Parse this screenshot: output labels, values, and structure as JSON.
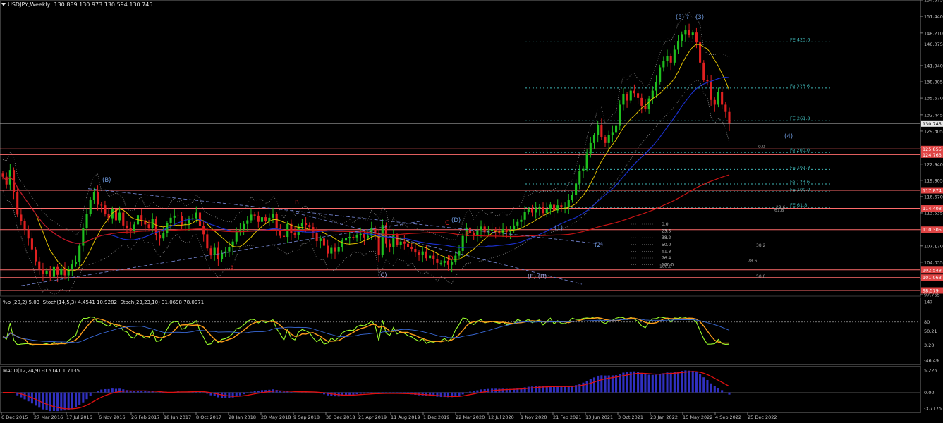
{
  "header": {
    "symbol_tf": "USDJPY,Weekly",
    "ohlc": "130.889 130.973 130.594 130.745"
  },
  "stoch_title": "%b (20,2) 5.03  Stoch(14,5,3) 4.4541 10.9282  Stoch(23,23,10) 31.0698 78.0971",
  "macd_title": "MACD(12,24,9) -0.5141 1.7135",
  "colors": {
    "bull": "#1fbf1f",
    "bear": "#e02020",
    "support": "#ff6b6b",
    "fib": "#3fb6b6",
    "ma_yellow": "#e0c000",
    "ma_blue": "#1a2fcc",
    "ma_red": "#c81414",
    "stoch_green": "#9aff2b",
    "stoch_orange": "#ff9e1a",
    "macd_hist": "#3030c0",
    "macd_signal": "#e01010",
    "current_price_box": "#e8e8e8"
  },
  "chart_data": {
    "type": "candlestick",
    "instrument": "USDJPY",
    "timeframe": "Weekly",
    "x_tick_labels": [
      "6 Dec 2015",
      "27 Mar 2016",
      "17 Jul 2016",
      "6 Nov 2016",
      "26 Feb 2017",
      "18 Jun 2017",
      "8 Oct 2017",
      "28 Jan 2018",
      "20 May 2018",
      "9 Sep 2018",
      "30 Dec 2018",
      "21 Apr 2019",
      "11 Aug 2019",
      "1 Dec 2019",
      "22 Mar 2020",
      "12 Jul 2020",
      "1 Nov 2020",
      "21 Feb 2021",
      "13 Jun 2021",
      "3 Oct 2021",
      "23 Jan 2022",
      "15 May 2022",
      "4 Sep 2022",
      "25 Dec 2022"
    ],
    "price_axis": {
      "ylim": [
        97.49,
        154.575
      ],
      "tick_labels": [
        "154.575",
        "151.440",
        "148.210",
        "146.075",
        "141.940",
        "138.805",
        "135.670",
        "132.445",
        "129.305",
        "126.170",
        "122.940",
        "119.805",
        "116.670",
        "113.535",
        "110.305",
        "107.170",
        "104.035",
        "100.900",
        "97.765"
      ]
    },
    "price_labels": [
      {
        "text": "130.745",
        "value": 130.745,
        "kind": "current"
      },
      {
        "text": "125.855",
        "value": 125.855,
        "kind": "level"
      },
      {
        "text": "124.763",
        "value": 124.763,
        "kind": "level"
      },
      {
        "text": "117.874",
        "value": 117.874,
        "kind": "level"
      },
      {
        "text": "114.408",
        "value": 114.408,
        "kind": "level"
      },
      {
        "text": "110.305",
        "value": 110.305,
        "kind": "level"
      },
      {
        "text": "102.548",
        "value": 102.548,
        "kind": "level"
      },
      {
        "text": "101.063",
        "value": 101.063,
        "kind": "level"
      },
      {
        "text": "98.579",
        "value": 98.579,
        "kind": "level"
      }
    ],
    "support_resistance_levels": [
      125.855,
      124.763,
      117.874,
      114.408,
      110.305,
      102.548,
      101.063,
      98.579
    ],
    "fib_levels": [
      {
        "label": "FE 423.6",
        "value": 146.5
      },
      {
        "label": "Fe 323.6",
        "value": 137.6
      },
      {
        "label": "FE 261.8",
        "value": 131.3
      },
      {
        "label": "Fe 200.0",
        "value": 125.2
      },
      {
        "label": "FE 161.8",
        "value": 121.9
      },
      {
        "label": "Fe 123.6",
        "value": 119.1
      },
      {
        "label": "FE 100.0",
        "value": 117.6
      },
      {
        "label": "FE 61.8",
        "value": 114.6
      }
    ],
    "retracement_labels": [
      "0.0",
      "23.6",
      "38.2",
      "50.0",
      "61.8",
      "78.6",
      "100.0"
    ],
    "small_fib_labels": [
      "0.0",
      "23.6",
      "38.2",
      "50.0",
      "61.8",
      "76.4",
      "100.0"
    ],
    "wave_labels": [
      "(5) ?",
      "(3)",
      "(4)",
      "(B)",
      "(D)",
      "(1)",
      "(2)",
      "(C)",
      "(E) (B)",
      "A",
      "B",
      "C",
      "D",
      "E"
    ],
    "weekly_closes": [
      120.5,
      119.0,
      121.8,
      117.6,
      113.2,
      112.0,
      110.3,
      108.6,
      106.5,
      104.2,
      102.7,
      101.8,
      102.4,
      101.2,
      103.1,
      101.6,
      102.8,
      101.5,
      102.8,
      103.6,
      104.1,
      107.2,
      110.6,
      113.3,
      116.1,
      117.6,
      115.1,
      115.0,
      113.3,
      112.5,
      114.3,
      112.1,
      113.6,
      111.1,
      110.6,
      110.0,
      111.3,
      113.1,
      112.1,
      111.3,
      110.6,
      112.3,
      109.3,
      108.6,
      109.7,
      111.5,
      112.6,
      113.0,
      112.9,
      111.2,
      111.4,
      112.5,
      112.5,
      113.6,
      111.0,
      109.4,
      106.7,
      105.4,
      106.8,
      104.6,
      105.8,
      106.1,
      106.9,
      108.0,
      109.9,
      110.3,
      111.4,
      112.1,
      113.2,
      113.0,
      111.8,
      112.7,
      111.9,
      112.6,
      113.3,
      110.5,
      109.1,
      108.9,
      111.4,
      109.6,
      109.2,
      110.9,
      111.5,
      111.2,
      110.8,
      109.6,
      108.1,
      108.6,
      107.2,
      105.7,
      106.8,
      106.1,
      106.9,
      108.2,
      108.7,
      108.9,
      108.8,
      109.2,
      109.5,
      108.8,
      109.1,
      110.6,
      109.5,
      105.4,
      111.2,
      107.6,
      107.0,
      109.2,
      107.4,
      108.0,
      107.6,
      106.9,
      106.6,
      105.9,
      105.4,
      106.1,
      104.8,
      105.3,
      104.6,
      103.9,
      103.9,
      104.3,
      103.5,
      104.0,
      105.3,
      106.2,
      109.1,
      110.7,
      109.6,
      109.1,
      110.2,
      110.9,
      109.8,
      110.1,
      110.3,
      110.0,
      109.7,
      110.4,
      109.9,
      110.2,
      111.1,
      111.8,
      112.2,
      113.7,
      114.2,
      113.6,
      114.4,
      114.7,
      113.5,
      114.3,
      115.1,
      114.0,
      115.0,
      114.6,
      114.7,
      116.0,
      117.0,
      119.2,
      121.6,
      122.0,
      125.0,
      127.0,
      128.5,
      130.5,
      128.1,
      127.0,
      128.5,
      129.1,
      130.3,
      134.4,
      136.4,
      135.2,
      137.1,
      136.6,
      135.7,
      134.2,
      133.5,
      135.6,
      137.1,
      138.8,
      141.6,
      142.8,
      143.8,
      142.5,
      145.0,
      146.7,
      148.0,
      148.8,
      147.8,
      148.3,
      146.4,
      142.5,
      139.2,
      138.9,
      135.3,
      134.4,
      136.8,
      134.4,
      133.0,
      130.7
    ],
    "indicators": [
      {
        "name": "Stochastic panel",
        "axis_labels": [
          "147",
          "80",
          "50.21",
          "3.20",
          "-46.49"
        ]
      },
      {
        "name": "MACD(12,24,9)",
        "macd": -0.5141,
        "signal": 1.7135,
        "axis_labels": [
          "5.226",
          "0.00",
          "-3.7175"
        ]
      }
    ]
  }
}
